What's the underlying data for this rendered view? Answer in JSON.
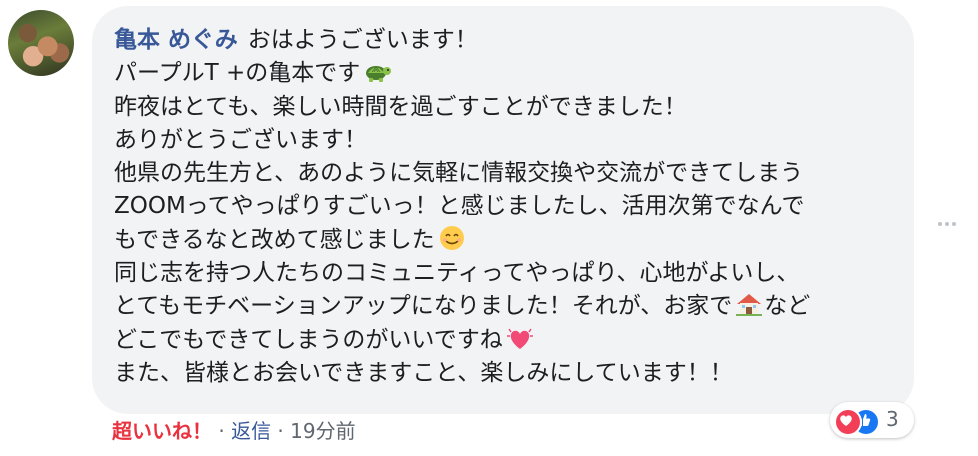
{
  "comment": {
    "author": "亀本 めぐみ",
    "lines": [
      "おはようございます！",
      "パープルT +の亀本です",
      "昨夜はとても、楽しい時間を過ごすことができました！",
      "ありがとうございます！",
      "他県の先生方と、あのように気軽に情報交換や交流ができてしまう",
      "ZOOMってやっぱりすごいっ！と感じましたし、活用次第でなんで",
      "もできるなと改めて感じました",
      "同じ志を持つ人たちのコミュニティってやっぱり、心地がよいし、",
      "とてもモチベーションアップになりました！それが、お家で",
      "どこでもできてしまうのがいいですね",
      "また、皆様とお会いできますこと、楽しみにしています！！"
    ],
    "line9_suffix": "など",
    "emojis": [
      "turtle-emoji",
      "smile-emoji",
      "house-emoji",
      "sparkling-heart-emoji"
    ]
  },
  "footer": {
    "reaction_label": "超いいね！",
    "separator": " · ",
    "reply_label": "返信",
    "time": "19分前"
  },
  "reactions": {
    "icons": [
      "love-icon",
      "like-icon"
    ],
    "count": "3"
  },
  "colors": {
    "author": "#385898",
    "reaction_label": "#e9323f",
    "bubble": "#f2f3f5",
    "text": "#1c1e21",
    "muted": "#606770"
  }
}
